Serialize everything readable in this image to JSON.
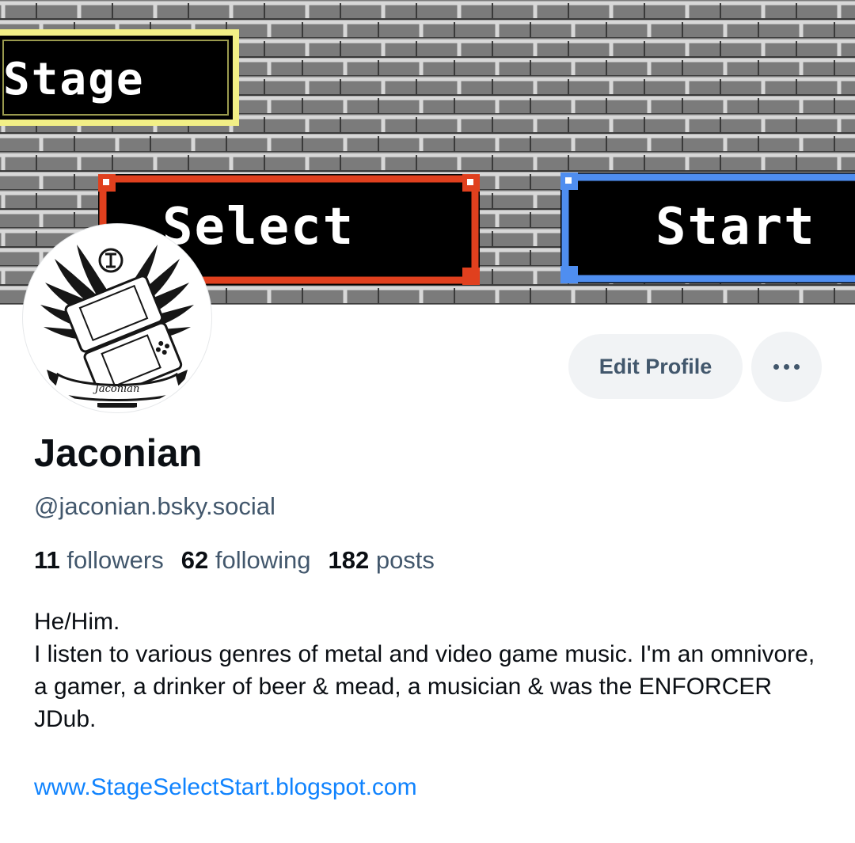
{
  "banner": {
    "labels": {
      "stage": "Stage",
      "select": "Select",
      "start": "Start"
    },
    "colors": {
      "wall": "#7b7b7b",
      "brick_highlight": "#d8d8d8",
      "stage_border": "#f2ef86",
      "select_border": "#e0401e",
      "start_border": "#4f8ef0"
    }
  },
  "avatar": {
    "caption": "Jaconian"
  },
  "actions": {
    "edit_profile_label": "Edit Profile",
    "more_icon": "more-dots-icon"
  },
  "profile": {
    "display_name": "Jaconian",
    "handle": "@jaconian.bsky.social",
    "stats": {
      "followers_count": "11",
      "followers_label": "followers",
      "following_count": "62",
      "following_label": "following",
      "posts_count": "182",
      "posts_label": "posts"
    },
    "bio": {
      "line1": "He/Him.",
      "line2": "I listen to various genres of metal and video game music. I'm an omnivore, a gamer, a drinker of beer & mead, a musician & was the ENFORCER JDub."
    },
    "website": "www.StageSelectStart.blogspot.com"
  },
  "colors": {
    "link": "#1083fe",
    "secondary_text": "#42576c",
    "button_bg": "#f1f3f5"
  }
}
